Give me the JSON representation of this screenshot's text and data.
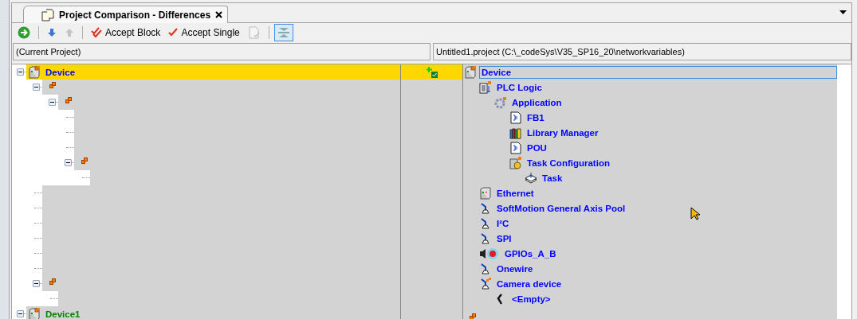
{
  "tab": {
    "title": "Project Comparison - Differences",
    "selected": true
  },
  "toolbar": [
    {
      "kind": "button",
      "disabled": false
    },
    {
      "kind": "separator"
    },
    {
      "kind": "button",
      "disabled": false
    },
    {
      "kind": "button",
      "disabled": true
    },
    {
      "kind": "separator"
    },
    {
      "kind": "button",
      "label": "Accept Block",
      "disabled": false
    },
    {
      "kind": "button",
      "label": "Accept Single",
      "disabled": false
    },
    {
      "kind": "button",
      "disabled": true
    },
    {
      "kind": "separator"
    },
    {
      "kind": "toggle",
      "on": true
    }
  ],
  "paths": {
    "left": "(Current Project)",
    "right": "Untitled1.project (C:\\_codeSys\\V35_SP16_20\\networkvariables)"
  },
  "tree": [
    {
      "left": {
        "kind": "device",
        "label": "Device",
        "unmatched": false
      },
      "changed": true,
      "right": {
        "kind": "device",
        "label": "Device",
        "focused": true
      },
      "expanded": true,
      "children": [
        {
          "left": {
            "kind": "link"
          },
          "right": {
            "kind": "plc-logic",
            "label": "PLC Logic"
          },
          "expanded": true,
          "children": [
            {
              "left": {
                "kind": "link"
              },
              "right": {
                "kind": "application",
                "label": "Application"
              },
              "expanded": true,
              "children": [
                {
                  "right": {
                    "kind": "pou",
                    "label": "FB1"
                  }
                },
                {
                  "right": {
                    "kind": "library",
                    "label": "Library Manager"
                  }
                },
                {
                  "right": {
                    "kind": "pou",
                    "label": "POU"
                  }
                },
                {
                  "left": {
                    "kind": "link"
                  },
                  "right": {
                    "kind": "task-config",
                    "label": "Task Configuration"
                  },
                  "expanded": true,
                  "children": [
                    {
                      "right": {
                        "kind": "task",
                        "label": "Task"
                      }
                    }
                  ]
                }
              ]
            }
          ]
        },
        {
          "right": {
            "kind": "ethernet",
            "label": "Ethernet"
          }
        },
        {
          "right": {
            "kind": "axis",
            "label": "SoftMotion General Axis Pool"
          }
        },
        {
          "right": {
            "kind": "axis",
            "label": "I²C"
          }
        },
        {
          "right": {
            "kind": "axis",
            "label": "SPI"
          }
        },
        {
          "right": {
            "kind": "gpio",
            "label": "GPIOs_A_B"
          }
        },
        {
          "right": {
            "kind": "axis",
            "label": "Onewire"
          }
        },
        {
          "left": {
            "kind": "link"
          },
          "right": {
            "kind": "camera",
            "label": "Camera device"
          },
          "expanded": true,
          "children": [
            {
              "right": {
                "kind": "empty-slot",
                "label": "<Empty>"
              }
            }
          ]
        }
      ]
    },
    {
      "left": {
        "kind": "device",
        "label": "Device1",
        "unmatched": true
      },
      "right": {
        "kind": "link"
      },
      "expanded": true
    }
  ]
}
